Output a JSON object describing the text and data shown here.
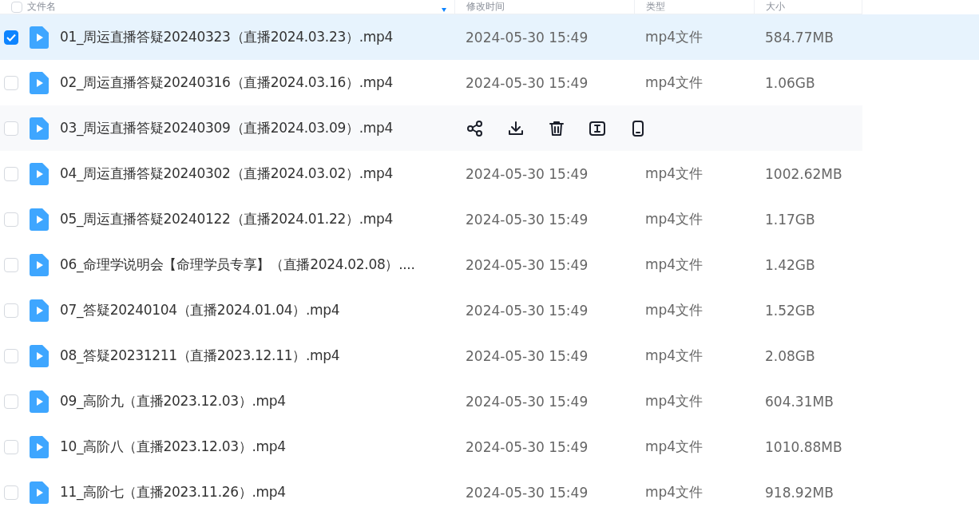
{
  "header": {
    "columns": [
      "文件名",
      "修改时间",
      "类型",
      "大小"
    ],
    "all_checked": false
  },
  "rows": [
    {
      "name": "01_周运直播答疑20240323（直播2024.03.23）.mp4",
      "time": "2024-05-30 15:49",
      "type": "mp4文件",
      "size": "584.77MB",
      "checked": true,
      "hovered": false
    },
    {
      "name": "02_周运直播答疑20240316（直播2024.03.16）.mp4",
      "time": "2024-05-30 15:49",
      "type": "mp4文件",
      "size": "1.06GB",
      "checked": false,
      "hovered": false
    },
    {
      "name": "03_周运直播答疑20240309（直播2024.03.09）.mp4",
      "checked": false,
      "hovered": true
    },
    {
      "name": "04_周运直播答疑20240302（直播2024.03.02）.mp4",
      "time": "2024-05-30 15:49",
      "type": "mp4文件",
      "size": "1002.62MB",
      "checked": false,
      "hovered": false
    },
    {
      "name": "05_周运直播答疑20240122（直播2024.01.22）.mp4",
      "time": "2024-05-30 15:49",
      "type": "mp4文件",
      "size": "1.17GB",
      "checked": false,
      "hovered": false
    },
    {
      "name": "06_命理学说明会【命理学员专享】（直播2024.02.08）....",
      "time": "2024-05-30 15:49",
      "type": "mp4文件",
      "size": "1.42GB",
      "checked": false,
      "hovered": false
    },
    {
      "name": "07_答疑20240104（直播2024.01.04）.mp4",
      "time": "2024-05-30 15:49",
      "type": "mp4文件",
      "size": "1.52GB",
      "checked": false,
      "hovered": false
    },
    {
      "name": "08_答疑20231211（直播2023.12.11）.mp4",
      "time": "2024-05-30 15:49",
      "type": "mp4文件",
      "size": "2.08GB",
      "checked": false,
      "hovered": false
    },
    {
      "name": "09_高阶九（直播2023.12.03）.mp4",
      "time": "2024-05-30 15:49",
      "type": "mp4文件",
      "size": "604.31MB",
      "checked": false,
      "hovered": false
    },
    {
      "name": "10_高阶八（直播2023.12.03）.mp4",
      "time": "2024-05-30 15:49",
      "type": "mp4文件",
      "size": "1010.88MB",
      "checked": false,
      "hovered": false
    },
    {
      "name": "11_高阶七（直播2023.11.26）.mp4",
      "time": "2024-05-30 15:49",
      "type": "mp4文件",
      "size": "918.92MB",
      "checked": false,
      "hovered": false
    }
  ]
}
